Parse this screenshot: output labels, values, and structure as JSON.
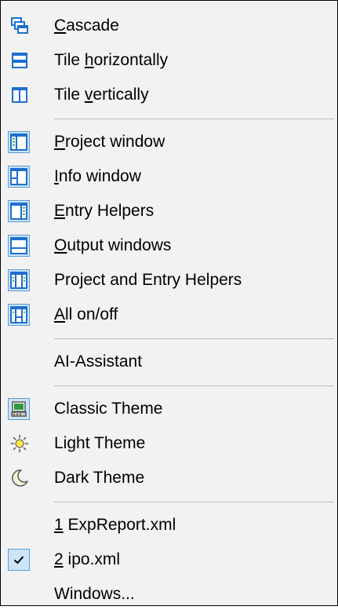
{
  "menu": {
    "items": [
      {
        "pre": "",
        "key": "C",
        "post": "ascade",
        "icon": "cascade-icon"
      },
      {
        "pre": "Tile ",
        "key": "h",
        "post": "orizontally",
        "icon": "tile-horizontal-icon"
      },
      {
        "pre": "Tile ",
        "key": "v",
        "post": "ertically",
        "icon": "tile-vertical-icon"
      },
      {
        "pre": "",
        "key": "P",
        "post": "roject window",
        "icon": "project-window-icon"
      },
      {
        "pre": "",
        "key": "I",
        "post": "nfo window",
        "icon": "info-window-icon"
      },
      {
        "pre": "",
        "key": "E",
        "post": "ntry Helpers",
        "icon": "entry-helpers-icon"
      },
      {
        "pre": "",
        "key": "O",
        "post": "utput windows",
        "icon": "output-windows-icon"
      },
      {
        "pre": "Pro",
        "key": "j",
        "post": "ect and Entry Helpers",
        "icon": "project-entry-helpers-icon"
      },
      {
        "pre": "",
        "key": "A",
        "post": "ll on/off",
        "icon": "all-on-off-icon"
      },
      {
        "pre": "AI-Assistant",
        "key": "",
        "post": "",
        "icon": ""
      },
      {
        "pre": "Classic Theme",
        "key": "",
        "post": "",
        "icon": "classic-theme-icon"
      },
      {
        "pre": "Light Theme",
        "key": "",
        "post": "",
        "icon": "sun-icon"
      },
      {
        "pre": "Dark Theme",
        "key": "",
        "post": "",
        "icon": "moon-icon"
      },
      {
        "pre": "",
        "key": "1",
        "post": " ExpReport.xml",
        "icon": ""
      },
      {
        "pre": "",
        "key": "2",
        "post": " ipo.xml",
        "icon": "checkmark-icon"
      },
      {
        "pre": "Windows...",
        "key": "",
        "post": "",
        "icon": ""
      }
    ]
  },
  "colors": {
    "menu_bg": "#f2f2f2",
    "icon_blue": "#1e6fcf",
    "highlight_fill": "#cce4f7",
    "highlight_border": "#5b9bd5",
    "separator": "#bdbdbd"
  }
}
